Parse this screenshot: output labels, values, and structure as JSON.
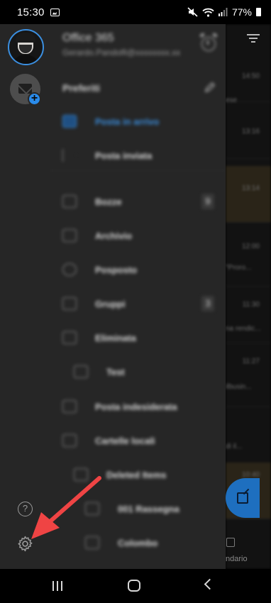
{
  "status_bar": {
    "time": "15:30",
    "battery": "77%"
  },
  "account": {
    "name": "Office 365",
    "email": "Gerardo.Pandolfi@xxxxxxxx.xx"
  },
  "favorites_label": "Preferiti",
  "folders": [
    {
      "label": "Posta in arrivo",
      "icon": "inbox-icon",
      "active": true
    },
    {
      "label": "Posta inviata",
      "icon": "send-icon"
    },
    {
      "label": "Bozze",
      "icon": "draft-icon",
      "count": "9"
    },
    {
      "label": "Archivio",
      "icon": "archive-icon"
    },
    {
      "label": "Posposto",
      "icon": "clock-icon"
    },
    {
      "label": "Gruppi",
      "icon": "groups-icon",
      "count": "3"
    },
    {
      "label": "Eliminata",
      "icon": "trash-icon"
    },
    {
      "label": "Test",
      "icon": "folder-icon"
    },
    {
      "label": "Posta indesiderata",
      "icon": "junk-icon"
    },
    {
      "label": "Cartelle locali",
      "icon": "folder-icon"
    },
    {
      "label": "Deleted Items",
      "icon": "folder-icon"
    },
    {
      "label": "001 Rassegna",
      "icon": "folder-icon"
    },
    {
      "label": "Colombo",
      "icon": "folder-icon"
    }
  ],
  "inbox_background": {
    "times": [
      "14:50",
      "13:16",
      "13:14",
      "12:00",
      "11:30",
      "11:27",
      "10:40"
    ],
    "snippets": [
      "ese",
      "vid...",
      "\"Proro...",
      "na rendic...",
      "ilbusin...",
      "di il...",
      "ndario"
    ]
  },
  "colors": {
    "accent": "#3b8fe0",
    "arrow": "#ef4444",
    "fab": "#1e6fbf"
  }
}
